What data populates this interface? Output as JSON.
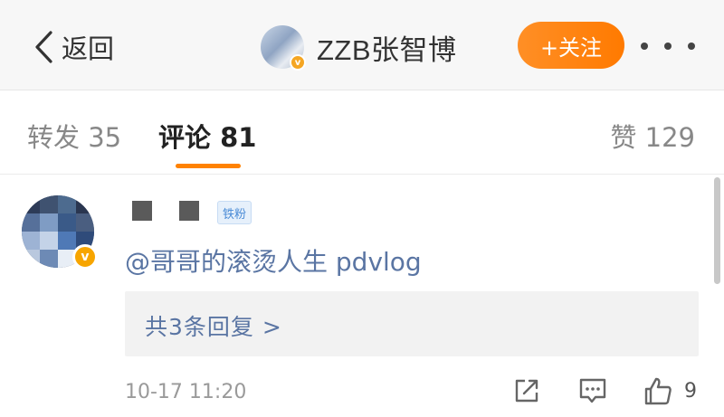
{
  "header": {
    "back_label": "返回",
    "user_name": "ZZB张智博",
    "follow_label": "+关注",
    "verified_badge": "v"
  },
  "tabs": [
    {
      "label": "转发",
      "count": "35",
      "active": false
    },
    {
      "label": "评论",
      "count": "81",
      "active": true
    },
    {
      "label": "赞",
      "count": "129",
      "active": false
    }
  ],
  "comment": {
    "fan_badge": "铁粉",
    "verified_badge": "v",
    "text": "@哥哥的滚烫人生 pdvlog",
    "replies_label": "共3条回复 >",
    "timestamp": "10-17 11:20",
    "like_count": "9"
  },
  "colors": {
    "accent": "#ff8200",
    "link": "#5a75a3",
    "badge_bg": "#e6f0fb"
  },
  "icons": [
    "back-chevron-icon",
    "more-dots-icon",
    "share-icon",
    "comment-icon",
    "thumbs-up-icon"
  ]
}
